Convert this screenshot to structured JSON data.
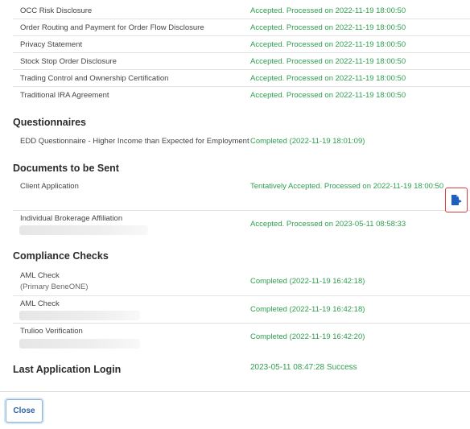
{
  "disclosures": [
    {
      "name": "OCC Risk Disclosure",
      "status": "Accepted. Processed on 2022-11-19 18:00:50"
    },
    {
      "name": "Order Routing and Payment for Order Flow Disclosure",
      "status": "Accepted. Processed on 2022-11-19 18:00:50"
    },
    {
      "name": "Privacy Statement",
      "status": "Accepted. Processed on 2022-11-19 18:00:50"
    },
    {
      "name": "Stock Stop Order Disclosure",
      "status": "Accepted. Processed on 2022-11-19 18:00:50"
    },
    {
      "name": "Trading Control and Ownership Certification",
      "status": "Accepted. Processed on 2022-11-19 18:00:50"
    },
    {
      "name": "Traditional IRA Agreement",
      "status": "Accepted. Processed on 2022-11-19 18:00:50"
    }
  ],
  "questionnaires": {
    "title": "Questionnaires",
    "items": [
      {
        "name": "EDD Questionnaire - Higher Income than Expected for Employment",
        "status": "Completed (2022-11-19 18:01:09)"
      }
    ]
  },
  "documents": {
    "title": "Documents to be Sent",
    "items": [
      {
        "name": "Client Application",
        "status": "Tentatively Accepted. Processed on 2022-11-19 18:00:50"
      },
      {
        "name": "Individual Brokerage Affiliation",
        "status": "Accepted. Processed on 2023-05-11 08:58:33"
      }
    ],
    "action_icon": "document-export-icon",
    "action_color": "#1f5fbf",
    "highlight_color": "#e03a3a"
  },
  "compliance": {
    "title": "Compliance Checks",
    "items": [
      {
        "name": "AML Check",
        "sub": "(Primary BeneONE)",
        "status": "Completed (2022-11-19 16:42:18)"
      },
      {
        "name": "AML Check",
        "status": "Completed (2022-11-19 16:42:18)"
      },
      {
        "name": "Trulioo Verification",
        "status": "Completed (2022-11-19 16:42:20)"
      }
    ]
  },
  "last_login": {
    "title": "Last Application Login",
    "value": "2023-05-11 08:47:28 Success"
  },
  "footer": {
    "close_label": "Close"
  },
  "colors": {
    "status_green": "#2e9e4e",
    "button_blue": "#2a64a8"
  }
}
